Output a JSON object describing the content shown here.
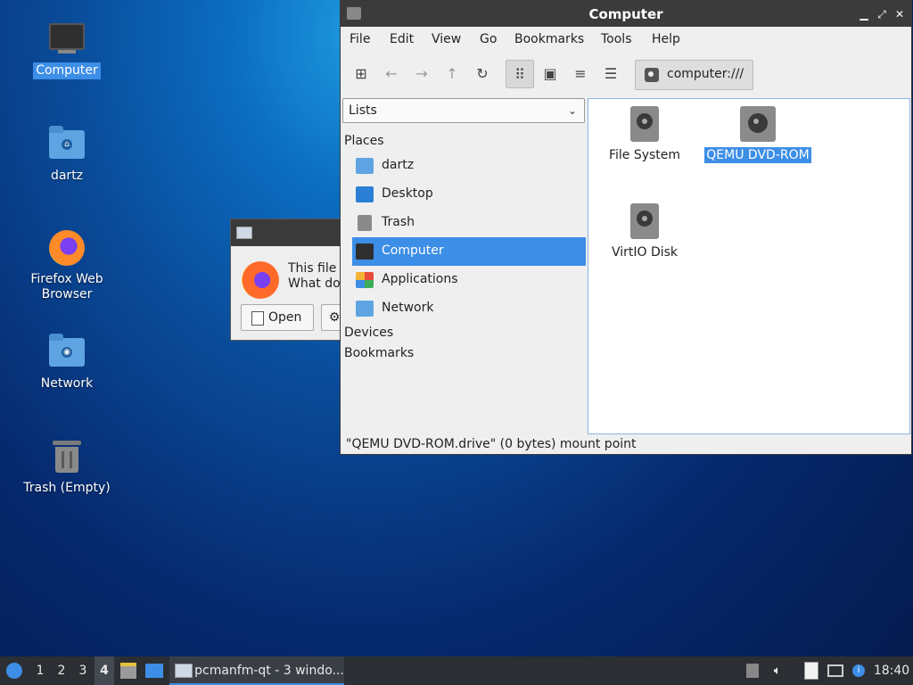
{
  "desktop": {
    "icons": [
      {
        "label": "Computer"
      },
      {
        "label": "dartz"
      },
      {
        "label": "Firefox Web Browser"
      },
      {
        "label": "Network"
      },
      {
        "label": "Trash (Empty)"
      }
    ]
  },
  "dialog": {
    "line1": "This file",
    "line2": "What do",
    "open_label": "Open"
  },
  "window": {
    "title": "Computer",
    "menu": [
      "File",
      "Edit",
      "View",
      "Go",
      "Bookmarks",
      "Tools",
      "Help"
    ],
    "path": "computer:///",
    "sidebar": {
      "view_mode": "Lists",
      "places_header": "Places",
      "places": [
        {
          "label": "dartz"
        },
        {
          "label": "Desktop"
        },
        {
          "label": "Trash"
        },
        {
          "label": "Computer",
          "selected": true
        },
        {
          "label": "Applications"
        },
        {
          "label": "Network"
        }
      ],
      "devices_header": "Devices",
      "bookmarks_header": "Bookmarks"
    },
    "items": [
      {
        "label": "File System"
      },
      {
        "label": "QEMU DVD-ROM",
        "selected": true
      },
      {
        "label": "VirtIO Disk"
      }
    ],
    "status": "\"QEMU DVD-ROM.drive\" (0 bytes) mount point"
  },
  "taskbar": {
    "workspaces": [
      "1",
      "2",
      "3",
      "4"
    ],
    "current_workspace": "4",
    "task_label": "pcmanfm-qt - 3 windo...",
    "clock": "18:40"
  },
  "colors": {
    "selection": "#3d8ee6",
    "titlebar": "#3b3b3b",
    "taskbar": "#2b2e33"
  }
}
